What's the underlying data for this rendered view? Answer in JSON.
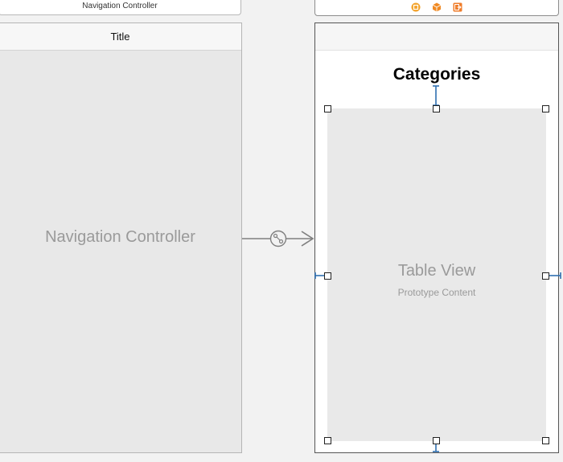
{
  "navigation_controller_scene": {
    "header_label": "Navigation Controller",
    "nav_bar_title": "Title",
    "placeholder_label": "Navigation Controller"
  },
  "table_view_controller_scene": {
    "dock_icons": [
      "view-controller-icon",
      "first-responder-icon",
      "exit-icon"
    ],
    "navigation_title": "Categories",
    "table_view": {
      "title": "Table View",
      "subtitle": "Prototype Content"
    }
  },
  "segue": {
    "icon": "relationship-segue-icon"
  },
  "colors": {
    "canvas": "#f2f2f2",
    "scene_placeholder": "#e8e8e8",
    "constraint": "#2f6fb0",
    "dock_icon_orange": "#f3a22a",
    "segue_line": "#7f7f7f"
  }
}
